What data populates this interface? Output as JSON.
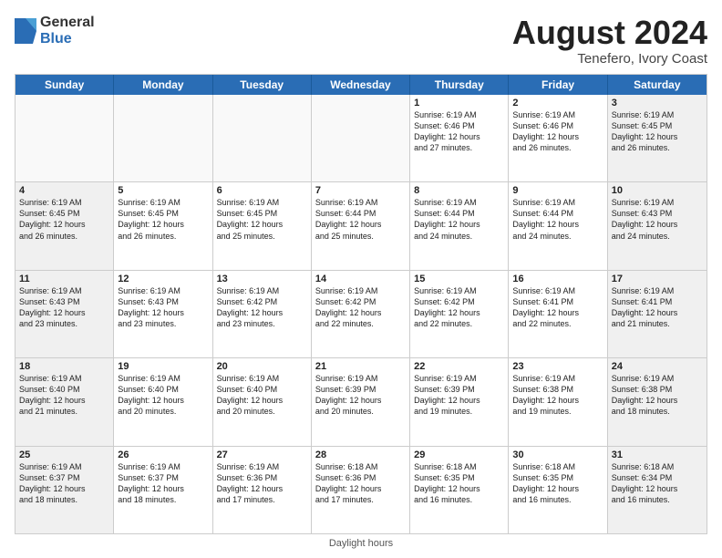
{
  "logo": {
    "general": "General",
    "blue": "Blue"
  },
  "title": {
    "month_year": "August 2024",
    "location": "Tenefero, Ivory Coast"
  },
  "header_days": [
    "Sunday",
    "Monday",
    "Tuesday",
    "Wednesday",
    "Thursday",
    "Friday",
    "Saturday"
  ],
  "footer": "Daylight hours",
  "weeks": [
    [
      {
        "day": "",
        "info": "",
        "empty": true
      },
      {
        "day": "",
        "info": "",
        "empty": true
      },
      {
        "day": "",
        "info": "",
        "empty": true
      },
      {
        "day": "",
        "info": "",
        "empty": true
      },
      {
        "day": "1",
        "info": "Sunrise: 6:19 AM\nSunset: 6:46 PM\nDaylight: 12 hours\nand 27 minutes.",
        "empty": false
      },
      {
        "day": "2",
        "info": "Sunrise: 6:19 AM\nSunset: 6:46 PM\nDaylight: 12 hours\nand 26 minutes.",
        "empty": false
      },
      {
        "day": "3",
        "info": "Sunrise: 6:19 AM\nSunset: 6:45 PM\nDaylight: 12 hours\nand 26 minutes.",
        "empty": false
      }
    ],
    [
      {
        "day": "4",
        "info": "Sunrise: 6:19 AM\nSunset: 6:45 PM\nDaylight: 12 hours\nand 26 minutes.",
        "empty": false
      },
      {
        "day": "5",
        "info": "Sunrise: 6:19 AM\nSunset: 6:45 PM\nDaylight: 12 hours\nand 26 minutes.",
        "empty": false
      },
      {
        "day": "6",
        "info": "Sunrise: 6:19 AM\nSunset: 6:45 PM\nDaylight: 12 hours\nand 25 minutes.",
        "empty": false
      },
      {
        "day": "7",
        "info": "Sunrise: 6:19 AM\nSunset: 6:44 PM\nDaylight: 12 hours\nand 25 minutes.",
        "empty": false
      },
      {
        "day": "8",
        "info": "Sunrise: 6:19 AM\nSunset: 6:44 PM\nDaylight: 12 hours\nand 24 minutes.",
        "empty": false
      },
      {
        "day": "9",
        "info": "Sunrise: 6:19 AM\nSunset: 6:44 PM\nDaylight: 12 hours\nand 24 minutes.",
        "empty": false
      },
      {
        "day": "10",
        "info": "Sunrise: 6:19 AM\nSunset: 6:43 PM\nDaylight: 12 hours\nand 24 minutes.",
        "empty": false
      }
    ],
    [
      {
        "day": "11",
        "info": "Sunrise: 6:19 AM\nSunset: 6:43 PM\nDaylight: 12 hours\nand 23 minutes.",
        "empty": false
      },
      {
        "day": "12",
        "info": "Sunrise: 6:19 AM\nSunset: 6:43 PM\nDaylight: 12 hours\nand 23 minutes.",
        "empty": false
      },
      {
        "day": "13",
        "info": "Sunrise: 6:19 AM\nSunset: 6:42 PM\nDaylight: 12 hours\nand 23 minutes.",
        "empty": false
      },
      {
        "day": "14",
        "info": "Sunrise: 6:19 AM\nSunset: 6:42 PM\nDaylight: 12 hours\nand 22 minutes.",
        "empty": false
      },
      {
        "day": "15",
        "info": "Sunrise: 6:19 AM\nSunset: 6:42 PM\nDaylight: 12 hours\nand 22 minutes.",
        "empty": false
      },
      {
        "day": "16",
        "info": "Sunrise: 6:19 AM\nSunset: 6:41 PM\nDaylight: 12 hours\nand 22 minutes.",
        "empty": false
      },
      {
        "day": "17",
        "info": "Sunrise: 6:19 AM\nSunset: 6:41 PM\nDaylight: 12 hours\nand 21 minutes.",
        "empty": false
      }
    ],
    [
      {
        "day": "18",
        "info": "Sunrise: 6:19 AM\nSunset: 6:40 PM\nDaylight: 12 hours\nand 21 minutes.",
        "empty": false
      },
      {
        "day": "19",
        "info": "Sunrise: 6:19 AM\nSunset: 6:40 PM\nDaylight: 12 hours\nand 20 minutes.",
        "empty": false
      },
      {
        "day": "20",
        "info": "Sunrise: 6:19 AM\nSunset: 6:40 PM\nDaylight: 12 hours\nand 20 minutes.",
        "empty": false
      },
      {
        "day": "21",
        "info": "Sunrise: 6:19 AM\nSunset: 6:39 PM\nDaylight: 12 hours\nand 20 minutes.",
        "empty": false
      },
      {
        "day": "22",
        "info": "Sunrise: 6:19 AM\nSunset: 6:39 PM\nDaylight: 12 hours\nand 19 minutes.",
        "empty": false
      },
      {
        "day": "23",
        "info": "Sunrise: 6:19 AM\nSunset: 6:38 PM\nDaylight: 12 hours\nand 19 minutes.",
        "empty": false
      },
      {
        "day": "24",
        "info": "Sunrise: 6:19 AM\nSunset: 6:38 PM\nDaylight: 12 hours\nand 18 minutes.",
        "empty": false
      }
    ],
    [
      {
        "day": "25",
        "info": "Sunrise: 6:19 AM\nSunset: 6:37 PM\nDaylight: 12 hours\nand 18 minutes.",
        "empty": false
      },
      {
        "day": "26",
        "info": "Sunrise: 6:19 AM\nSunset: 6:37 PM\nDaylight: 12 hours\nand 18 minutes.",
        "empty": false
      },
      {
        "day": "27",
        "info": "Sunrise: 6:19 AM\nSunset: 6:36 PM\nDaylight: 12 hours\nand 17 minutes.",
        "empty": false
      },
      {
        "day": "28",
        "info": "Sunrise: 6:18 AM\nSunset: 6:36 PM\nDaylight: 12 hours\nand 17 minutes.",
        "empty": false
      },
      {
        "day": "29",
        "info": "Sunrise: 6:18 AM\nSunset: 6:35 PM\nDaylight: 12 hours\nand 16 minutes.",
        "empty": false
      },
      {
        "day": "30",
        "info": "Sunrise: 6:18 AM\nSunset: 6:35 PM\nDaylight: 12 hours\nand 16 minutes.",
        "empty": false
      },
      {
        "day": "31",
        "info": "Sunrise: 6:18 AM\nSunset: 6:34 PM\nDaylight: 12 hours\nand 16 minutes.",
        "empty": false
      }
    ]
  ]
}
